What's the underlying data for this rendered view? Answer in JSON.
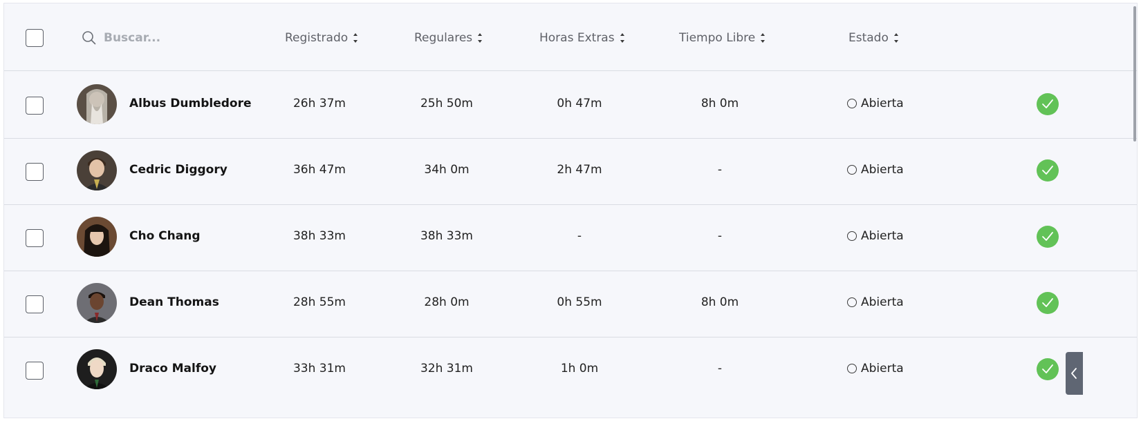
{
  "search": {
    "placeholder": "Buscar..."
  },
  "columns": {
    "registrado": "Registrado",
    "regulares": "Regulares",
    "horas_extras": "Horas Extras",
    "tiempo_libre": "Tiempo Libre",
    "estado": "Estado"
  },
  "rows": [
    {
      "name": "Albus Dumbledore",
      "registrado": "26h 37m",
      "regulares": "25h 50m",
      "horas_extras": "0h 47m",
      "tiempo_libre": "8h 0m",
      "estado": "Abierta"
    },
    {
      "name": "Cedric Diggory",
      "registrado": "36h 47m",
      "regulares": "34h 0m",
      "horas_extras": "2h 47m",
      "tiempo_libre": "-",
      "estado": "Abierta"
    },
    {
      "name": "Cho Chang",
      "registrado": "38h 33m",
      "regulares": "38h 33m",
      "horas_extras": "-",
      "tiempo_libre": "-",
      "estado": "Abierta"
    },
    {
      "name": "Dean Thomas",
      "registrado": "28h 55m",
      "regulares": "28h 0m",
      "horas_extras": "0h 55m",
      "tiempo_libre": "8h 0m",
      "estado": "Abierta"
    },
    {
      "name": "Draco Malfoy",
      "registrado": "33h 31m",
      "regulares": "32h 31m",
      "horas_extras": "1h 0m",
      "tiempo_libre": "-",
      "estado": "Abierta"
    }
  ],
  "colors": {
    "approve": "#62c257",
    "side_tab": "#5f6673",
    "background": "#f6f7fb"
  },
  "icons": {
    "search": "search-icon",
    "sort": "sort-icon",
    "approve": "check-icon",
    "status": "circle-open-icon",
    "side_tab": "chevron-left-icon"
  }
}
